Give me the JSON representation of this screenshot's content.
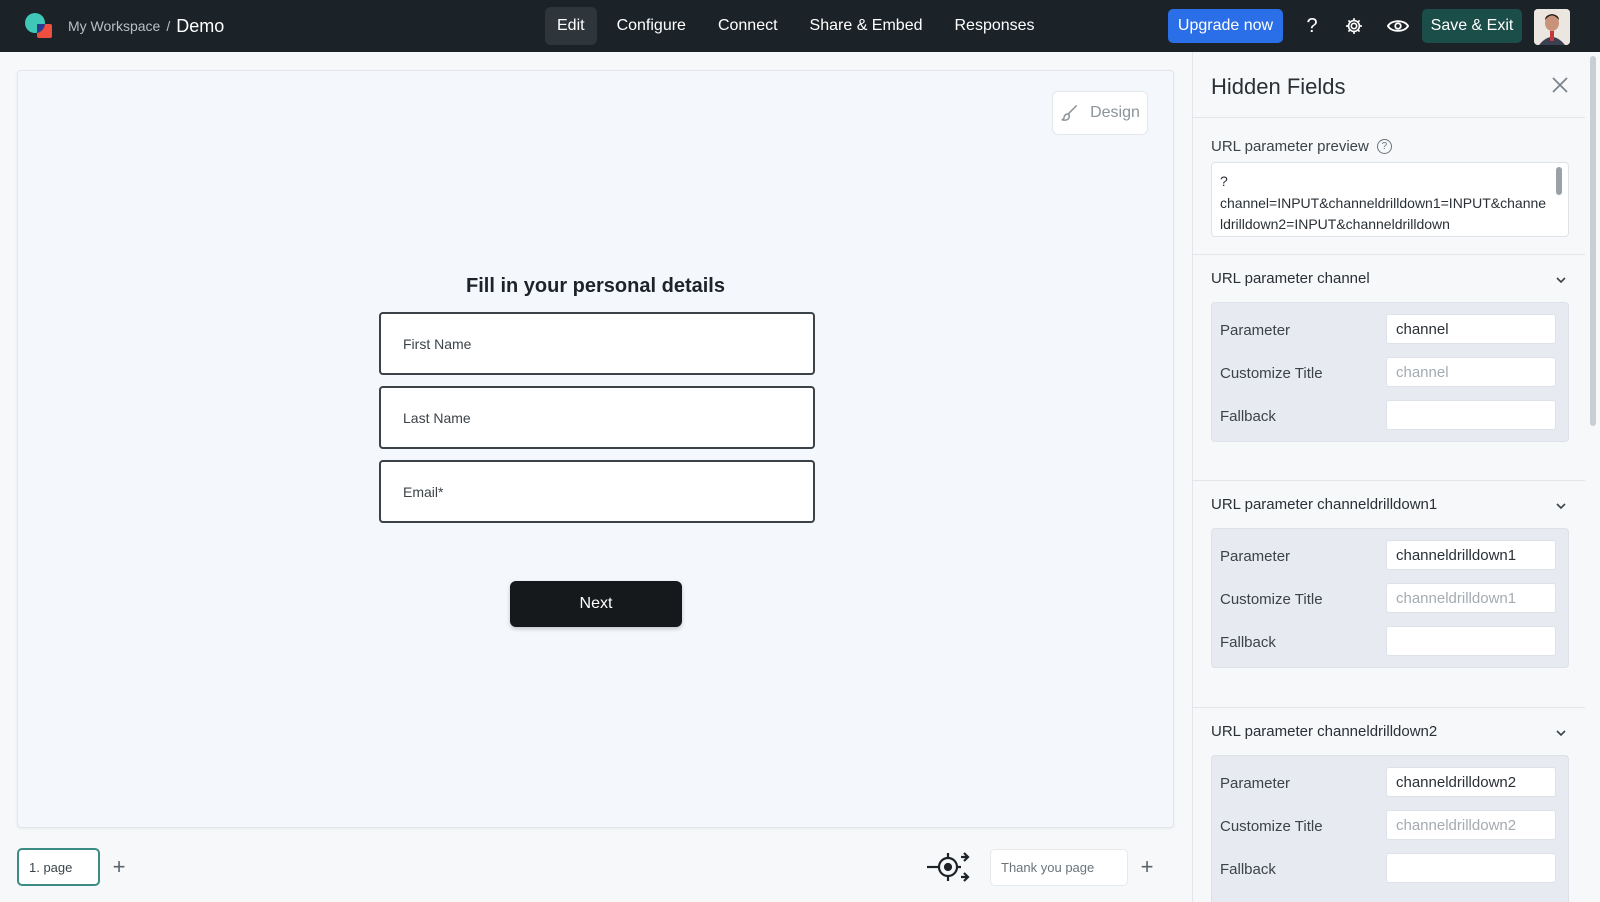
{
  "header": {
    "workspace": "My Workspace",
    "separator": "/",
    "project": "Demo",
    "nav": [
      "Edit",
      "Configure",
      "Connect",
      "Share & Embed",
      "Responses"
    ],
    "active_nav": "Edit",
    "upgrade_label": "Upgrade now",
    "save_exit_label": "Save & Exit",
    "help_glyph": "?",
    "icons": [
      "help-icon",
      "gear-icon",
      "eye-icon"
    ]
  },
  "canvas": {
    "design_label": "Design",
    "form_title": "Fill in your personal details",
    "fields": [
      "First Name",
      "Last Name",
      "Email*"
    ],
    "next_label": "Next"
  },
  "bottom": {
    "page_tab": "1. page",
    "thank_you_tab": "Thank you page",
    "add_glyph": "+"
  },
  "panel": {
    "title": "Hidden Fields",
    "preview_label": "URL parameter preview",
    "preview_text": "?\nchannel=INPUT&channeldrilldown1=INPUT&channeldrilldown2=INPUT&channeldrilldown",
    "row_labels": {
      "parameter": "Parameter",
      "customize_title": "Customize Title",
      "fallback": "Fallback"
    },
    "sections": [
      {
        "title": "URL parameter channel",
        "parameter": "channel",
        "title_placeholder": "channel",
        "fallback": ""
      },
      {
        "title": "URL parameter channeldrilldown1",
        "parameter": "channeldrilldown1",
        "title_placeholder": "channeldrilldown1",
        "fallback": ""
      },
      {
        "title": "URL parameter channeldrilldown2",
        "parameter": "channeldrilldown2",
        "title_placeholder": "channeldrilldown2",
        "fallback": ""
      }
    ]
  },
  "colors": {
    "topbar": "#1c2328",
    "upgrade": "#2b6fe8",
    "save_exit": "#1b4d49",
    "page_tab_border": "#3c8c84",
    "next_button": "#16191c"
  }
}
